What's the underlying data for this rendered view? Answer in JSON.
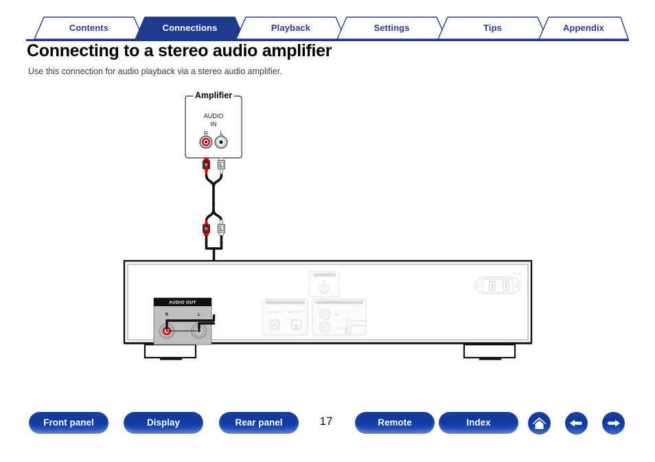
{
  "nav_tabs": [
    {
      "label": "Contents",
      "active": false
    },
    {
      "label": "Connections",
      "active": true
    },
    {
      "label": "Playback",
      "active": false
    },
    {
      "label": "Settings",
      "active": false
    },
    {
      "label": "Tips",
      "active": false
    },
    {
      "label": "Appendix",
      "active": false
    }
  ],
  "page": {
    "title": "Connecting to a stereo audio amplifier",
    "intro": "Use this connection for audio playback via a stereo audio amplifier.",
    "number": "17"
  },
  "diagram": {
    "amplifier": {
      "title": "Amplifier",
      "jack_group": "AUDIO",
      "jack_direction": "IN",
      "right_label": "R",
      "left_label": "L"
    },
    "cable": {
      "top_right_plug": "R",
      "top_left_plug": "L",
      "bottom_right_plug": "R",
      "bottom_left_plug": "L"
    },
    "device_rear": {
      "audio_out": {
        "header": "AUDIO OUT",
        "right_label": "R",
        "left_label": "L"
      },
      "digital_audio_out": {
        "header": "DIGITAL AUDIO OUT",
        "coaxial": "COAXIAL",
        "optical": "OPTICAL"
      },
      "remote_control": {
        "header": "REMOTE CONTROL",
        "in": "IN",
        "out": "OUT",
        "external": "EXTERNAL",
        "internal": "INTERNAL"
      },
      "rs232c": {
        "header": "RS-232C",
        "in": "IN"
      },
      "ac_in": "AC IN"
    }
  },
  "footer": {
    "buttons": [
      {
        "label": "Front panel"
      },
      {
        "label": "Display"
      },
      {
        "label": "Rear panel"
      },
      {
        "label": "Remote"
      },
      {
        "label": "Index"
      }
    ],
    "icons": [
      {
        "name": "home-icon"
      },
      {
        "name": "arrow-left-icon"
      },
      {
        "name": "arrow-right-icon"
      }
    ]
  },
  "colors": {
    "brand_blue": "#1d3a8f",
    "tab_text": "#2a3b8f",
    "active_tab_bg": "#1d3a8f",
    "red_jack": "#cc0000"
  }
}
